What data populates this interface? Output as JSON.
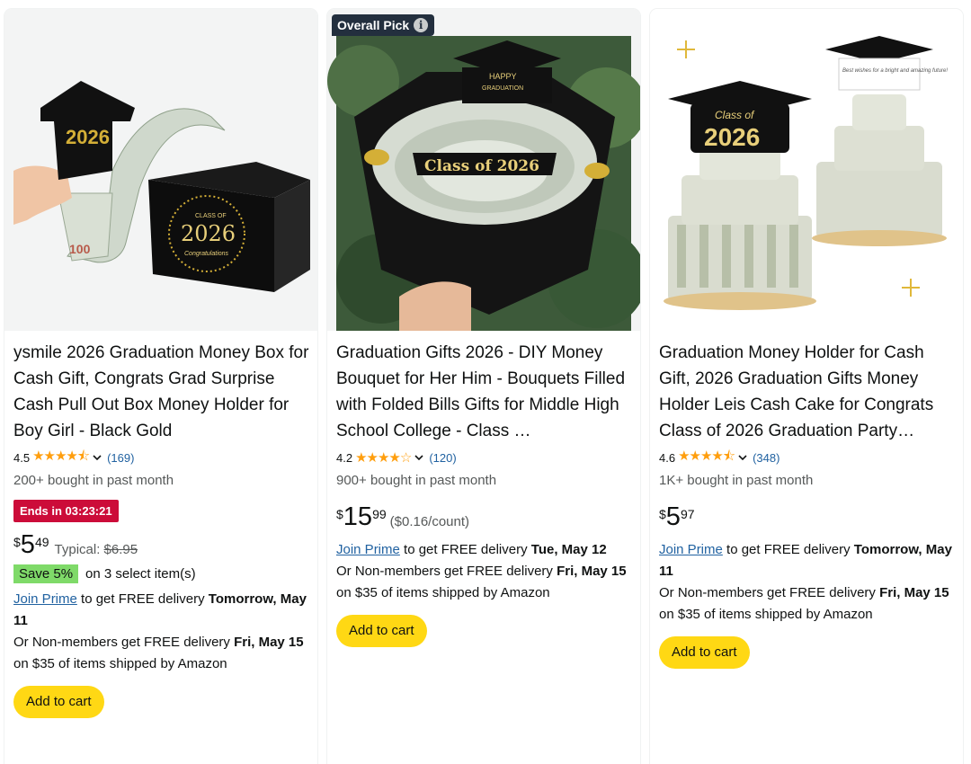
{
  "products": [
    {
      "title": "ysmile 2026 Graduation Money Box for Cash Gift, Congrats Grad Surprise Cash Pull Out Box Money Holder for Boy Girl - Black Gold",
      "rating": "4.5",
      "stars": "★★★★⯪",
      "review_count": "(169)",
      "bought": "200+ bought in past month",
      "deal": "Ends in 03:23:21",
      "price_symbol": "$",
      "price_whole": "5",
      "price_fraction": "49",
      "typical_label": "Typical:",
      "typical_price": "$6.95",
      "save_badge": "Save 5%",
      "save_text": "on 3 select item(s)",
      "join_prime": "Join Prime",
      "delivery_prefix": " to get FREE delivery ",
      "delivery_date": "Tomorrow, May 11",
      "nonmember_prefix": "Or Non-members get FREE delivery ",
      "nonmember_date": "Fri, May 15",
      "nonmember_suffix": " on $35 of items shipped by Amazon",
      "add_to_cart": "Add to cart",
      "image_labels": [
        "2026",
        "100",
        "CLASS OF",
        "2026",
        "Congratulations"
      ]
    },
    {
      "badge": "Overall Pick",
      "title": "Graduation Gifts 2026 - DIY Money Bouquet for Her Him - Bouquets Filled with Folded Bills Gifts for Middle High School College - Class …",
      "rating": "4.2",
      "stars": "★★★★☆",
      "review_count": "(120)",
      "bought": "900+ bought in past month",
      "price_symbol": "$",
      "price_whole": "15",
      "price_fraction": "99",
      "unit_price": "($0.16/count)",
      "join_prime": "Join Prime",
      "delivery_prefix": " to get FREE delivery ",
      "delivery_date": "Tue, May 12",
      "nonmember_prefix": "Or Non-members get FREE delivery ",
      "nonmember_date": "Fri, May 15",
      "nonmember_suffix": " on $35 of items shipped by Amazon",
      "add_to_cart": "Add to cart",
      "image_labels": [
        "HAPPY",
        "GRADUATION",
        "Class of 2026"
      ]
    },
    {
      "title": "Graduation Money Holder for Cash Gift, 2026 Graduation Gifts Money Holder Leis Cash Cake for Congrats Class of 2026 Graduation Party…",
      "rating": "4.6",
      "stars": "★★★★⯪",
      "review_count": "(348)",
      "bought": "1K+ bought in past month",
      "price_symbol": "$",
      "price_whole": "5",
      "price_fraction": "97",
      "join_prime": "Join Prime",
      "delivery_prefix": " to get FREE delivery ",
      "delivery_date": "Tomorrow, May 11",
      "nonmember_prefix": "Or Non-members get FREE delivery ",
      "nonmember_date": "Fri, May 15",
      "nonmember_suffix": " on $35 of items shipped by Amazon",
      "add_to_cart": "Add to cart",
      "image_labels": [
        "Class of",
        "2026",
        "Best wishes for a bright and amazing future!"
      ]
    }
  ],
  "colors": {
    "star": "#ff9e0d",
    "link": "#2162a1",
    "deal_red": "#cc0c39",
    "save_green": "#7fda69",
    "cart_yellow": "#ffd814",
    "badge_dark": "#232f3e"
  },
  "icons": [
    "info-icon",
    "chevron-down-icon"
  ]
}
